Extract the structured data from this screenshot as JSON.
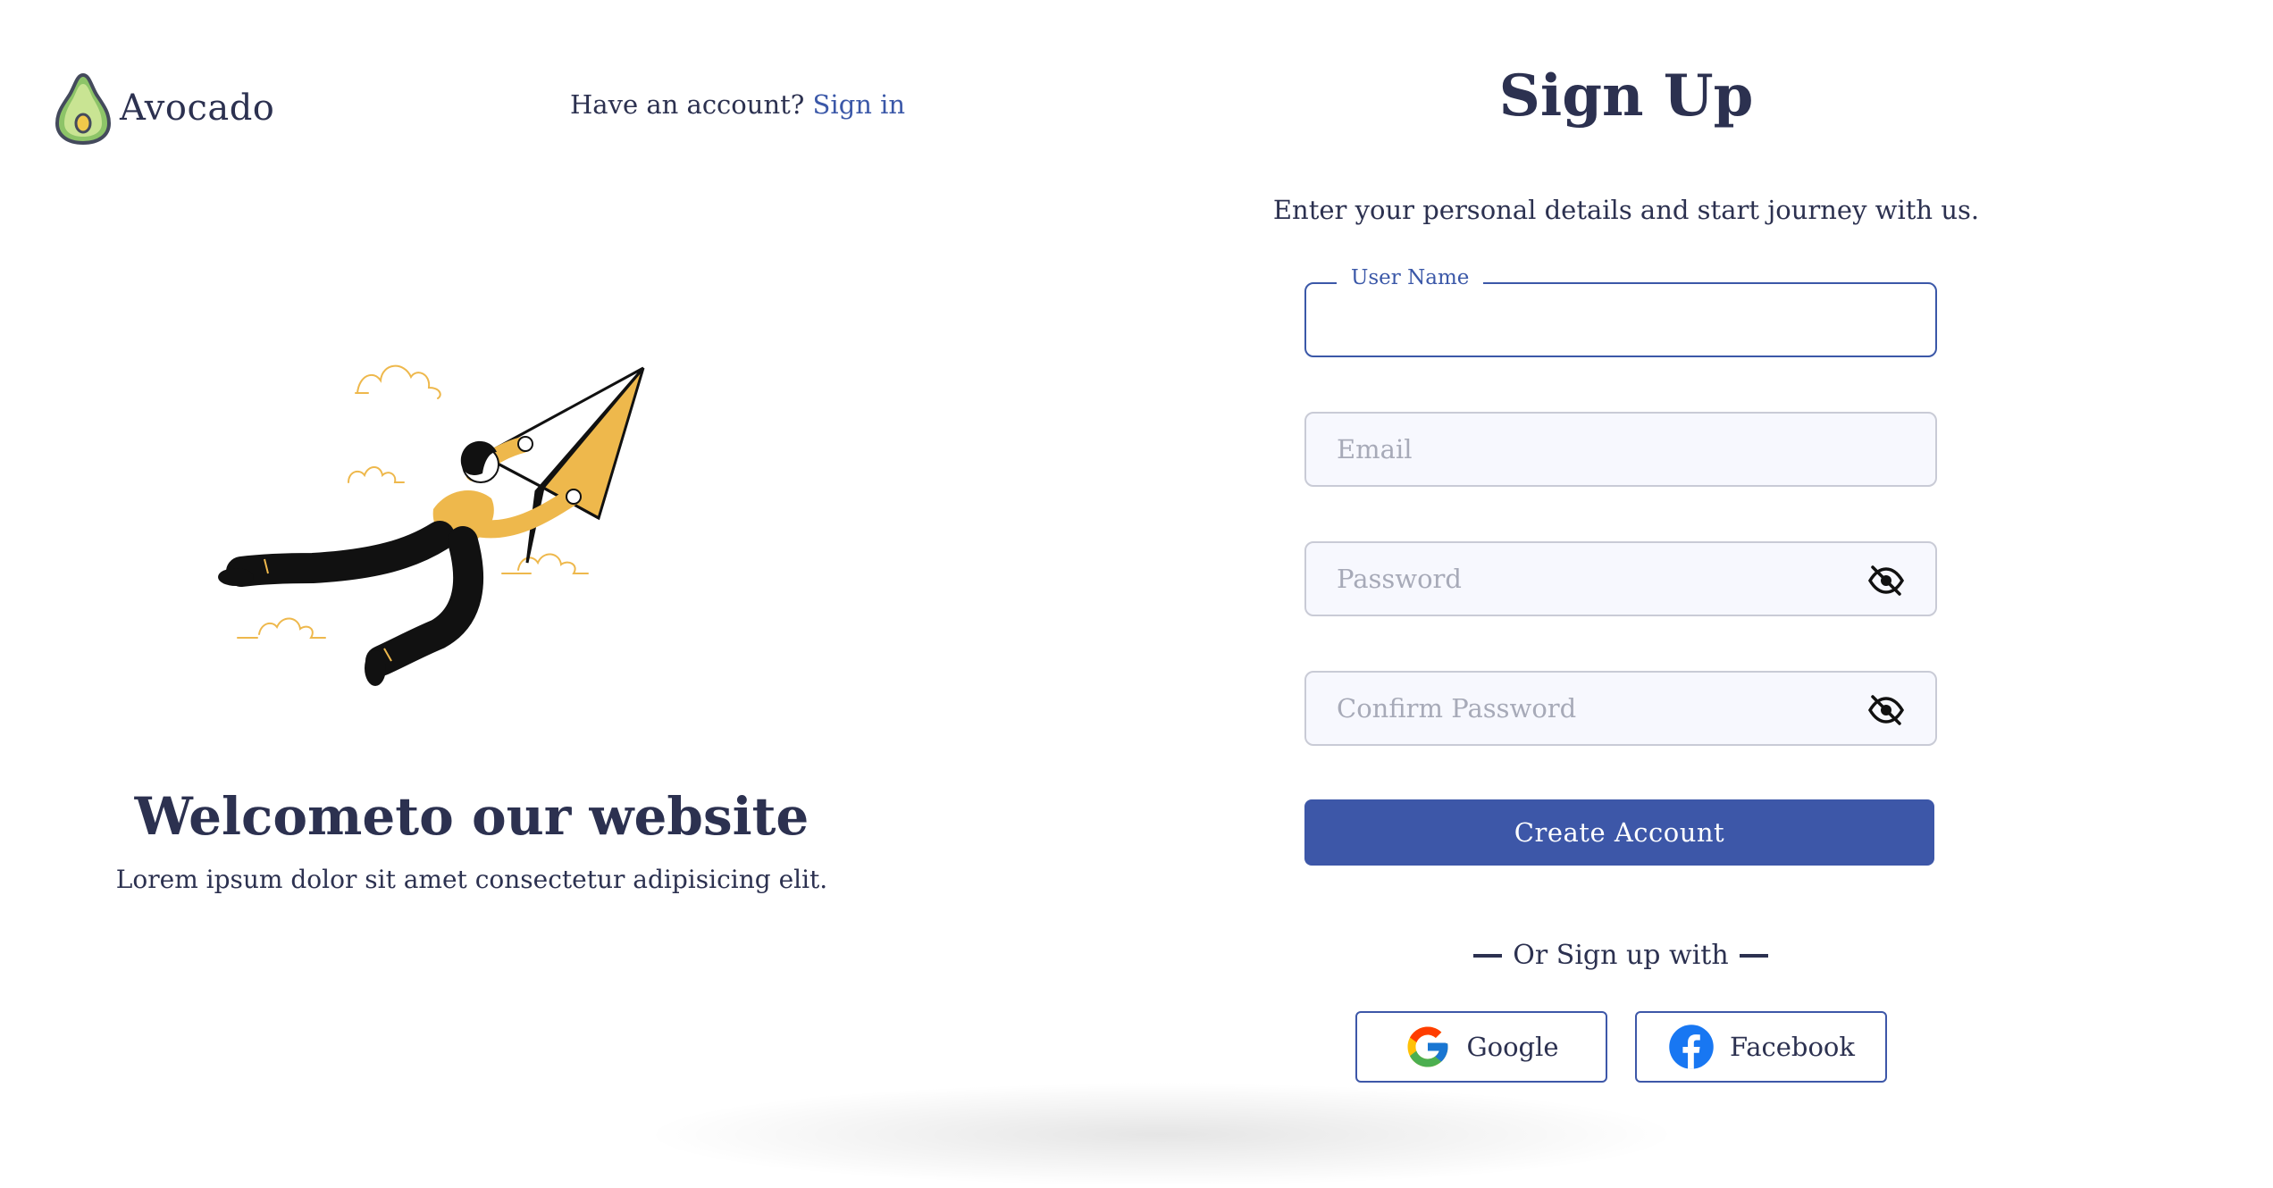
{
  "brand": {
    "name": "Avocado"
  },
  "header": {
    "have_account_text": "Have an account?",
    "signin_link": "Sign in"
  },
  "welcome": {
    "title": "Welcometo our website",
    "subtitle": "Lorem ipsum dolor sit amet consectetur adipisicing elit."
  },
  "signup": {
    "title": "Sign Up",
    "subtitle": "Enter your personal details and start journey with us.",
    "fields": {
      "username": {
        "label": "User Name",
        "value": "",
        "placeholder": ""
      },
      "email": {
        "placeholder": "Email",
        "value": ""
      },
      "password": {
        "placeholder": "Password",
        "value": "",
        "icon": "eye-off-icon"
      },
      "confirm_password": {
        "placeholder": "Confirm Password",
        "value": "",
        "icon": "eye-off-icon"
      }
    },
    "create_button": "Create Account",
    "divider_text": "Or Sign up with",
    "social": {
      "google": {
        "label": "Google",
        "icon": "google-icon"
      },
      "facebook": {
        "label": "Facebook",
        "icon": "facebook-icon"
      }
    }
  },
  "colors": {
    "primary": "#3d57a8",
    "text": "#2c3150",
    "link": "#3b58a8",
    "illustration_accent": "#eeb84c",
    "input_bg": "#f7f8fe"
  }
}
